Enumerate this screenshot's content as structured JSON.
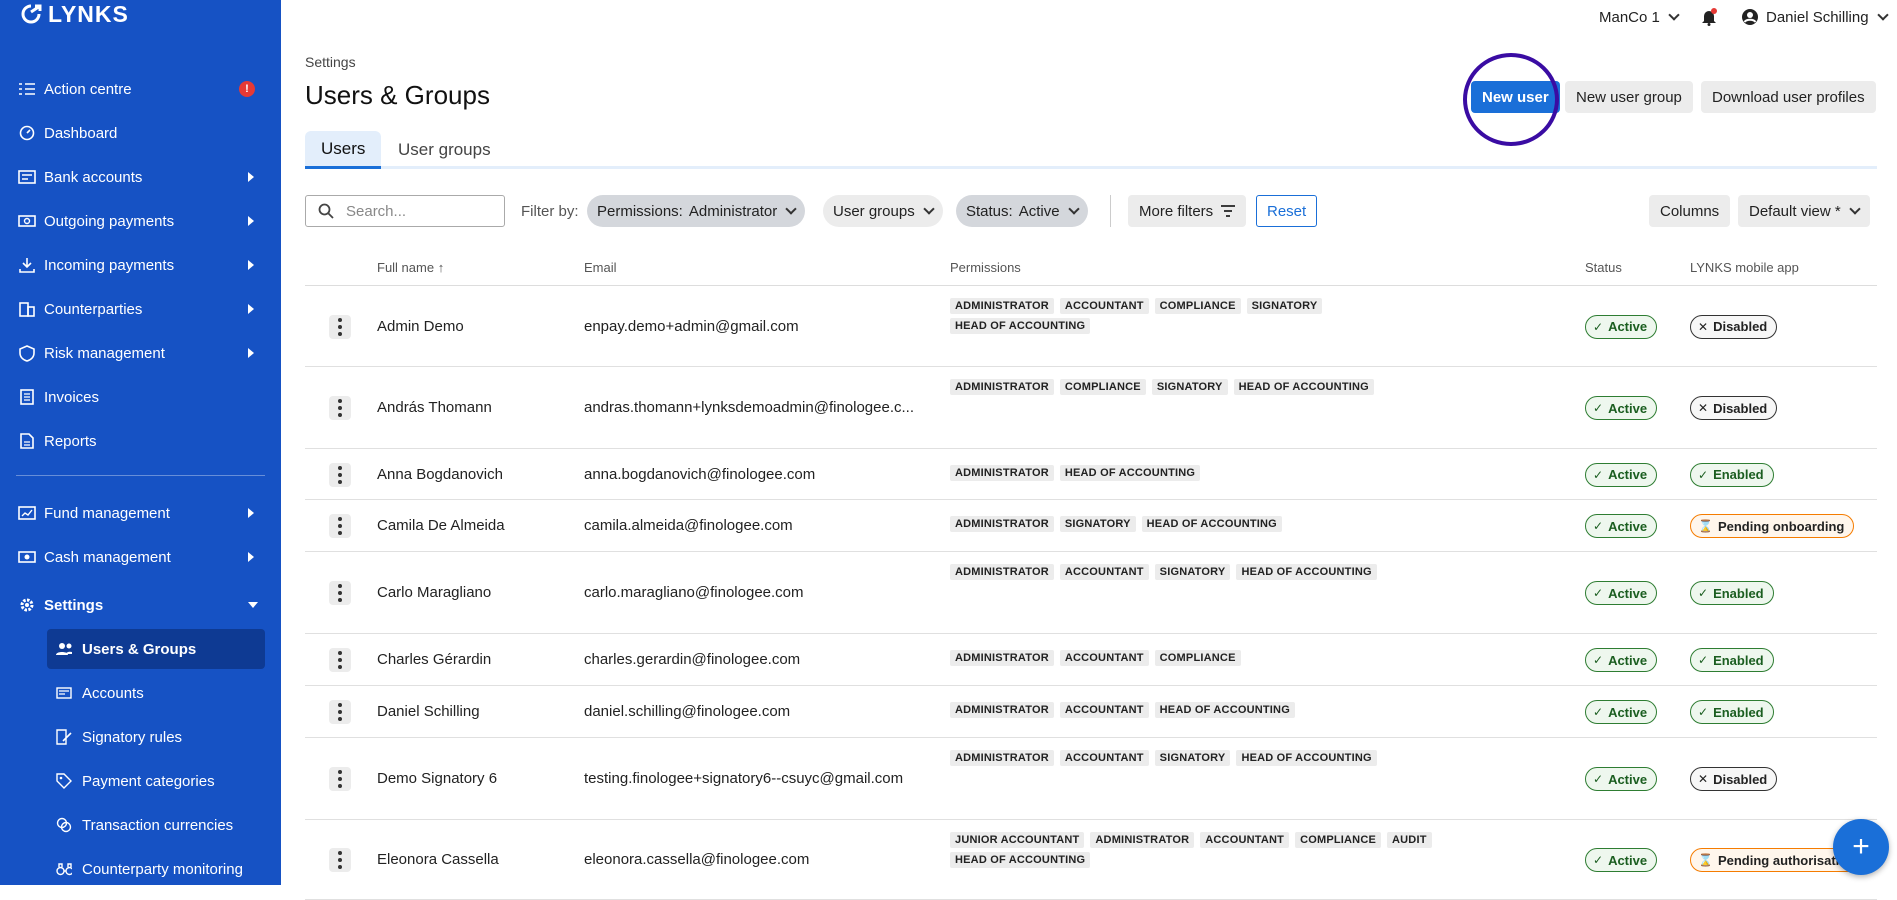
{
  "app": {
    "brand": "LYNKS"
  },
  "sidebar": {
    "items": [
      {
        "label": "Action centre",
        "icon": "list-check-icon",
        "badge": "!"
      },
      {
        "label": "Dashboard",
        "icon": "gauge-icon"
      },
      {
        "label": "Bank accounts",
        "icon": "bank-card-icon"
      },
      {
        "label": "Outgoing payments",
        "icon": "cash-out-icon"
      },
      {
        "label": "Incoming payments",
        "icon": "download-icon"
      },
      {
        "label": "Counterparties",
        "icon": "building-icon"
      },
      {
        "label": "Risk management",
        "icon": "shield-icon"
      },
      {
        "label": "Invoices",
        "icon": "invoice-icon"
      },
      {
        "label": "Reports",
        "icon": "report-icon"
      },
      {
        "label": "Fund management",
        "icon": "chart-icon"
      },
      {
        "label": "Cash management",
        "icon": "cash-icon"
      },
      {
        "label": "Settings",
        "icon": "gear-icon"
      }
    ],
    "sub_items": [
      {
        "label": "Users & Groups",
        "icon": "users-icon"
      },
      {
        "label": "Accounts",
        "icon": "account-icon"
      },
      {
        "label": "Signatory rules",
        "icon": "signature-icon"
      },
      {
        "label": "Payment categories",
        "icon": "tag-icon"
      },
      {
        "label": "Transaction currencies",
        "icon": "coins-icon"
      },
      {
        "label": "Counterparty monitoring",
        "icon": "binoculars-icon"
      }
    ]
  },
  "topbar": {
    "company": "ManCo 1",
    "user": "Daniel Schilling"
  },
  "header": {
    "breadcrumb": "Settings",
    "title": "Users & Groups",
    "new_user": "New user",
    "new_user_group": "New user group",
    "download": "Download user profiles"
  },
  "tabs": [
    "Users",
    "User groups"
  ],
  "filters": {
    "search_placeholder": "Search...",
    "filter_by": "Filter by:",
    "permissions_label": "Permissions:",
    "permissions_value": "Administrator",
    "user_groups": "User groups",
    "status_label": "Status:",
    "status_value": "Active",
    "more_filters": "More filters",
    "reset": "Reset",
    "columns": "Columns",
    "default_view": "Default view *"
  },
  "table": {
    "headers": {
      "name": "Full name",
      "email": "Email",
      "permissions": "Permissions",
      "status": "Status",
      "app": "LYNKS mobile app"
    },
    "rows": [
      {
        "name": "Admin Demo",
        "email": "enpay.demo+admin@gmail.com",
        "perms": [
          "ADMINISTRATOR",
          "ACCOUNTANT",
          "COMPLIANCE",
          "SIGNATORY",
          "HEAD OF ACCOUNTING"
        ],
        "status": "Active",
        "app": "Disabled"
      },
      {
        "name": "András Thomann",
        "email": "andras.thomann+lynksdemoadmin@finologee.c...",
        "perms": [
          "ADMINISTRATOR",
          "COMPLIANCE",
          "SIGNATORY",
          "HEAD OF ACCOUNTING"
        ],
        "status": "Active",
        "app": "Disabled"
      },
      {
        "name": "Anna Bogdanovich",
        "email": "anna.bogdanovich@finologee.com",
        "perms": [
          "ADMINISTRATOR",
          "HEAD OF ACCOUNTING"
        ],
        "status": "Active",
        "app": "Enabled"
      },
      {
        "name": "Camila De Almeida",
        "email": "camila.almeida@finologee.com",
        "perms": [
          "ADMINISTRATOR",
          "SIGNATORY",
          "HEAD OF ACCOUNTING"
        ],
        "status": "Active",
        "app": "Pending onboarding"
      },
      {
        "name": "Carlo Maragliano",
        "email": "carlo.maragliano@finologee.com",
        "perms": [
          "ADMINISTRATOR",
          "ACCOUNTANT",
          "SIGNATORY",
          "HEAD OF ACCOUNTING"
        ],
        "status": "Active",
        "app": "Enabled"
      },
      {
        "name": "Charles Gérardin",
        "email": "charles.gerardin@finologee.com",
        "perms": [
          "ADMINISTRATOR",
          "ACCOUNTANT",
          "COMPLIANCE"
        ],
        "status": "Active",
        "app": "Enabled"
      },
      {
        "name": "Daniel Schilling",
        "email": "daniel.schilling@finologee.com",
        "perms": [
          "ADMINISTRATOR",
          "ACCOUNTANT",
          "HEAD OF ACCOUNTING"
        ],
        "status": "Active",
        "app": "Enabled"
      },
      {
        "name": "Demo Signatory 6",
        "email": "testing.finologee+signatory6--csuyc@gmail.com",
        "perms": [
          "ADMINISTRATOR",
          "ACCOUNTANT",
          "SIGNATORY",
          "HEAD OF ACCOUNTING"
        ],
        "status": "Active",
        "app": "Disabled"
      },
      {
        "name": "Eleonora Cassella",
        "email": "eleonora.cassella@finologee.com",
        "perms": [
          "JUNIOR ACCOUNTANT",
          "ADMINISTRATOR",
          "ACCOUNTANT",
          "COMPLIANCE",
          "AUDIT",
          "HEAD OF ACCOUNTING"
        ],
        "status": "Active",
        "app": "Pending authorisation"
      }
    ]
  },
  "fab": "+"
}
